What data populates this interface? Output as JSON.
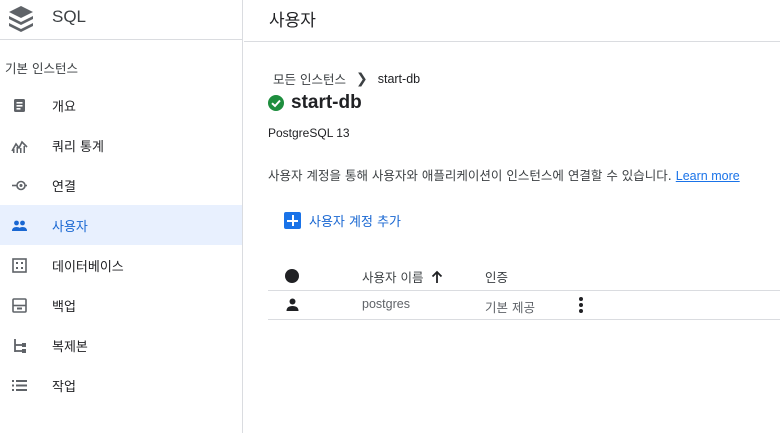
{
  "app": {
    "title": "SQL"
  },
  "sidebar": {
    "section_label": "기본 인스턴스",
    "items": [
      {
        "label": "개요",
        "icon": "overview-icon"
      },
      {
        "label": "쿼리 통계",
        "icon": "query-insights-icon"
      },
      {
        "label": "연결",
        "icon": "connections-icon"
      },
      {
        "label": "사용자",
        "icon": "users-icon",
        "active": true
      },
      {
        "label": "데이터베이스",
        "icon": "databases-icon"
      },
      {
        "label": "백업",
        "icon": "backups-icon"
      },
      {
        "label": "복제본",
        "icon": "replicas-icon"
      },
      {
        "label": "작업",
        "icon": "operations-icon"
      }
    ]
  },
  "header": {
    "title": "사용자"
  },
  "breadcrumb": {
    "parent": "모든 인스턴스",
    "current": "start-db"
  },
  "instance": {
    "name": "start-db",
    "status": "running",
    "version": "PostgreSQL 13"
  },
  "description": {
    "text": "사용자 계정을 통해 사용자와 애플리케이션이 인스턴스에 연결할 수 있습니다.",
    "link": "Learn more"
  },
  "add_button": {
    "label": "사용자 계정 추가"
  },
  "table": {
    "headers": {
      "name": "사용자 이름",
      "auth": "인증"
    },
    "rows": [
      {
        "name": "postgres",
        "auth": "기본 제공"
      }
    ]
  },
  "colors": {
    "accent": "#1a73e8",
    "active_bg": "#e8f0fe",
    "success": "#1e8e3e"
  }
}
